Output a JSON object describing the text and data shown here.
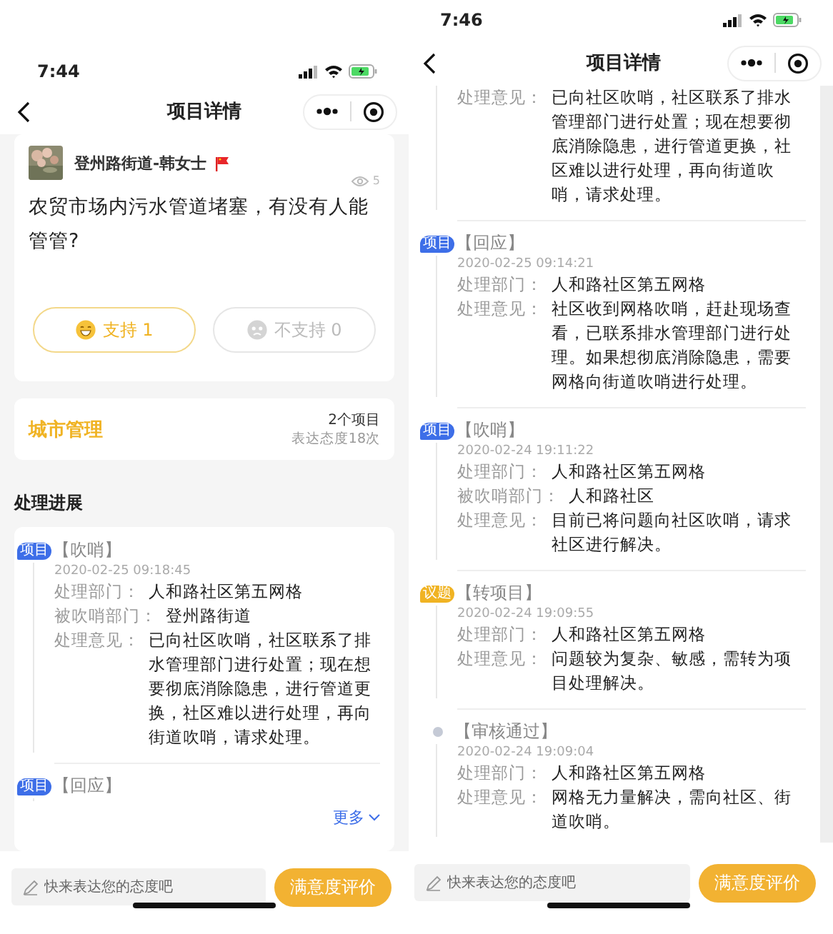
{
  "screens": [
    {
      "time": "7:44",
      "title": "项目详情",
      "post": {
        "author": "登州路街道-韩女士",
        "views": "5",
        "question": "农贸市场内污水管道堵塞，有没有人能管管?",
        "votes": [
          {
            "label": "支持 1",
            "kind": "support",
            "selected": true
          },
          {
            "label": "不支持 0",
            "kind": "oppose",
            "selected": false
          }
        ]
      },
      "category": {
        "name": "城市管理",
        "count": "2个项目",
        "attitudes": "表达态度18次"
      },
      "progress_title": "处理进展",
      "timeline": [
        {
          "marker": {
            "kind": "badge",
            "text": "项目",
            "color": "#3d6ee8"
          },
          "title": "【吹哨】",
          "time": "2020-02-25 09:18:45",
          "fields": [
            {
              "label": "处理部门：",
              "value": "人和路社区第五网格"
            },
            {
              "label": "被吹哨部门：",
              "value": "登州路街道"
            },
            {
              "label": "处理意见：",
              "value": "已向社区吹哨，社区联系了排水管理部门进行处置；现在想要彻底消除隐患，进行管道更换，社区难以进行处理，再向街道吹哨，请求处理。"
            }
          ]
        },
        {
          "marker": {
            "kind": "badge",
            "text": "项目",
            "color": "#3d6ee8"
          },
          "title": "【回应】"
        }
      ],
      "more": "更多",
      "comment_placeholder": "快来表达您的态度吧",
      "rate_button": "满意度评价"
    },
    {
      "time": "7:46",
      "title": "项目详情",
      "timeline": [
        {
          "fields": [
            {
              "label": "处理意见：",
              "value": "已向社区吹哨，社区联系了排水管理部门进行处置；现在想要彻底消除隐患，进行管道更换，社区难以进行处理，再向街道吹哨，请求处理。"
            }
          ]
        },
        {
          "marker": {
            "kind": "badge",
            "text": "项目",
            "color": "#3d6ee8"
          },
          "title": "【回应】",
          "time": "2020-02-25 09:14:21",
          "fields": [
            {
              "label": "处理部门：",
              "value": "人和路社区第五网格"
            },
            {
              "label": "处理意见：",
              "value": "社区收到网格吹哨，赶赴现场查看，已联系排水管理部门进行处理。如果想彻底消除隐患，需要网格向街道吹哨进行处理。"
            }
          ]
        },
        {
          "marker": {
            "kind": "badge",
            "text": "项目",
            "color": "#3d6ee8"
          },
          "title": "【吹哨】",
          "time": "2020-02-24 19:11:22",
          "fields": [
            {
              "label": "处理部门：",
              "value": "人和路社区第五网格"
            },
            {
              "label": "被吹哨部门：",
              "value": "人和路社区"
            },
            {
              "label": "处理意见：",
              "value": "目前已将问题向社区吹哨，请求社区进行解决。"
            }
          ]
        },
        {
          "marker": {
            "kind": "badge",
            "text": "议题",
            "color": "#f0b323"
          },
          "title": "【转项目】",
          "time": "2020-02-24 19:09:55",
          "fields": [
            {
              "label": "处理部门：",
              "value": "人和路社区第五网格"
            },
            {
              "label": "处理意见：",
              "value": "问题较为复杂、敏感，需转为项目处理解决。"
            }
          ]
        },
        {
          "marker": {
            "kind": "dot",
            "color": "#c5cad6"
          },
          "title": "【审核通过】",
          "time": "2020-02-24 19:09:04",
          "fields": [
            {
              "label": "处理部门：",
              "value": "人和路社区第五网格"
            },
            {
              "label": "处理意见：",
              "value": "网格无力量解决，需向社区、街道吹哨。"
            }
          ]
        }
      ],
      "comment_placeholder": "快来表达您的态度吧",
      "rate_button": "满意度评价"
    }
  ]
}
